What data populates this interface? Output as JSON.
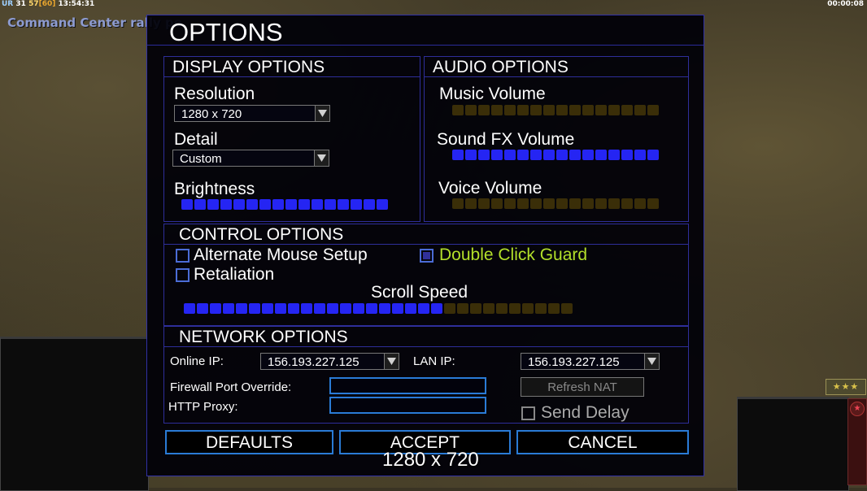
{
  "hud": {
    "top_left": {
      "ur": "UR",
      "val1": "31",
      "fps": "57",
      "cap": "[60]",
      "time": "13:54:31"
    },
    "top_right": "00:00:08",
    "rally_message": "Command Center rally po",
    "rank_stars": "★★★"
  },
  "dialog": {
    "title": "OPTIONS",
    "display": {
      "header": "DISPLAY OPTIONS",
      "resolution_label": "Resolution",
      "resolution_value": "1280 x 720",
      "detail_label": "Detail",
      "detail_value": "Custom",
      "brightness_label": "Brightness",
      "brightness_level": "16/16"
    },
    "audio": {
      "header": "AUDIO OPTIONS",
      "music_label": "Music Volume",
      "music_level": "0/16",
      "sfx_label": "Sound FX Volume",
      "sfx_level": "16/16",
      "voice_label": "Voice Volume",
      "voice_level": "0/16"
    },
    "control": {
      "header": "CONTROL OPTIONS",
      "alt_mouse_label": "Alternate Mouse Setup",
      "alt_mouse_checked": false,
      "double_click_label": "Double Click Guard",
      "double_click_checked": true,
      "double_click_color": "#b3e02a",
      "retaliation_label": "Retaliation",
      "retaliation_checked": false,
      "scroll_label": "Scroll Speed",
      "scroll_level": "20/30"
    },
    "network": {
      "header": "NETWORK OPTIONS",
      "online_ip_label": "Online IP:",
      "online_ip_value": "156.193.227.125",
      "lan_ip_label": "LAN IP:",
      "lan_ip_value": "156.193.227.125",
      "firewall_label": "Firewall Port Override:",
      "firewall_value": "",
      "http_proxy_label": "HTTP Proxy:",
      "http_proxy_value": "",
      "refresh_nat_label": "Refresh NAT",
      "send_delay_label": "Send Delay",
      "send_delay_checked": false
    },
    "buttons": {
      "defaults": "DEFAULTS",
      "accept": "ACCEPT",
      "cancel": "CANCEL"
    }
  },
  "overlay_caption": "1280 x 720",
  "colors": {
    "accent_blue": "#2525f3",
    "border_blue": "#2e2e9a",
    "button_border": "#2a7bd6",
    "slider_off": "#3a2e08"
  }
}
